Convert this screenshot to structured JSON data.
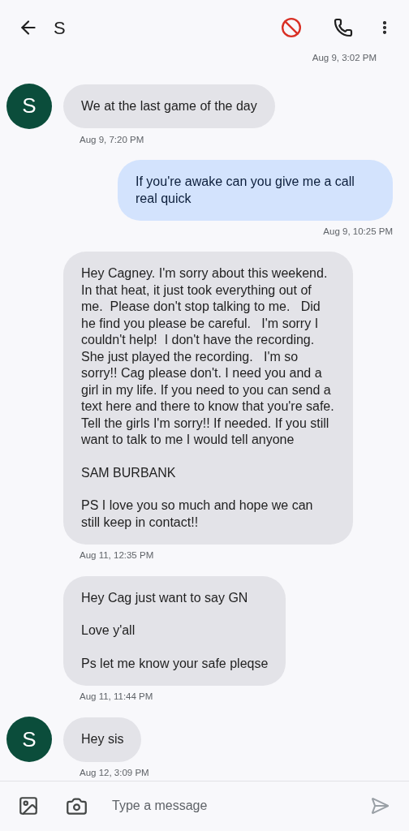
{
  "header": {
    "title": "S"
  },
  "top_timestamp": "Aug 9, 3:02 PM",
  "messages": [
    {
      "kind": "incoming",
      "avatar": "S",
      "paragraphs": [
        "We at the last game of the day"
      ],
      "time": "Aug 9, 7:20 PM"
    },
    {
      "kind": "outgoing",
      "paragraphs": [
        "If you're awake can you give me a call real quick"
      ],
      "time": "Aug 9, 10:25 PM"
    },
    {
      "kind": "incoming",
      "paragraphs": [
        "Hey Cagney. I'm sorry about this weekend. In that heat, it just took everything out of me.  Please don't stop talking to me.   Did he find you please be careful.   I'm sorry I couldn't help!  I don't have the recording. She just played the recording.   I'm so sorry!! Cag please don't. I need you and a girl in my life. If you need to you can send a text here and there to know that you're safe.   Tell the girls I'm sorry!! If needed. If you still want to talk to me I would tell anyone",
        "SAM BURBANK",
        "PS I love you so much and hope we can still keep in contact!!"
      ],
      "time": "Aug 11, 12:35 PM"
    },
    {
      "kind": "incoming",
      "paragraphs": [
        "Hey Cag just want to say GN",
        "Love y'all",
        "Ps let me know your safe pleqse"
      ],
      "time": "Aug 11, 11:44 PM"
    },
    {
      "kind": "incoming",
      "avatar": "S",
      "paragraphs": [
        "Hey sis"
      ],
      "time": "Aug 12, 3:09 PM"
    }
  ],
  "composer": {
    "placeholder": "Type a message"
  }
}
